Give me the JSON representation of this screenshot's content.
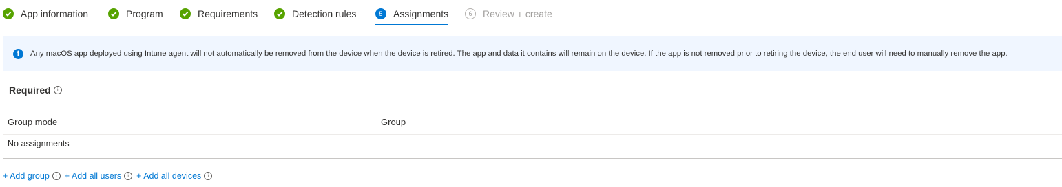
{
  "wizard": {
    "steps": [
      {
        "label": "App information",
        "state": "complete"
      },
      {
        "label": "Program",
        "state": "complete"
      },
      {
        "label": "Requirements",
        "state": "complete"
      },
      {
        "label": "Detection rules",
        "state": "complete"
      },
      {
        "label": "Assignments",
        "state": "active",
        "number": "5"
      },
      {
        "label": "Review + create",
        "state": "disabled",
        "number": "6"
      }
    ]
  },
  "info_bar": {
    "icon": "info-icon",
    "text": "Any macOS app deployed using Intune agent will not automatically be removed from the device when the device is retired. The app and data it contains will remain on the device. If the app is not removed prior to retiring the device, the end user will need to manually remove the app."
  },
  "required": {
    "title": "Required",
    "columns": [
      "Group mode",
      "Group"
    ],
    "empty_text": "No assignments"
  },
  "actions": {
    "add_group": "+ Add group",
    "add_all_users": "+ Add all users",
    "add_all_devices": "+ Add all devices"
  },
  "colors": {
    "accent": "#0078d4",
    "success": "#57a300",
    "info_background": "#f0f6ff"
  }
}
